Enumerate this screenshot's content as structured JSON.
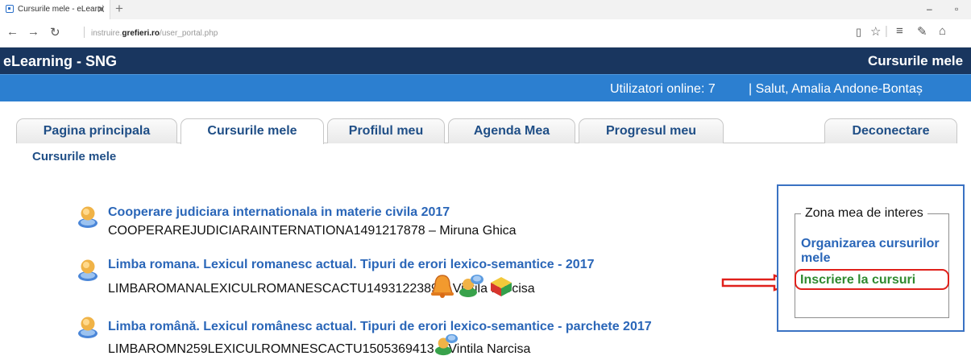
{
  "browser": {
    "tab_title": "Cursurile mele - eLearni",
    "tab_close": "✕",
    "new_tab": "+",
    "url_prefix": "instruire.",
    "url_domain": "grefieri.ro",
    "url_path": "/user_portal.php",
    "minimize": "–",
    "restore": "▫"
  },
  "header": {
    "brand": "eLearning - SNG",
    "section": "Cursurile mele",
    "online_label": "Utilizatori online:  7",
    "greeting": "| Salut, Amalia Andone-Bontaș"
  },
  "tabs": [
    {
      "label": "Pagina principala"
    },
    {
      "label": "Cursurile mele"
    },
    {
      "label": "Profilul meu"
    },
    {
      "label": "Agenda Mea"
    },
    {
      "label": "Progresul meu"
    }
  ],
  "logout": "Deconectare",
  "breadcrumb": "Cursurile mele",
  "courses": [
    {
      "title": "Cooperare judiciara internationala in materie civila 2017",
      "code": "COOPERAREJUDICIARAINTERNATIONA1491217878 – Miruna Ghica"
    },
    {
      "title": "Limba romana. Lexicul romanesc actual. Tipuri de erori lexico-semantice - 2017",
      "code": "LIMBAROMANALEXICULROMANESCACTU1493122389 – Vintila Narcisa"
    },
    {
      "title": "Limba română. Lexicul românesc actual. Tipuri de erori lexico-semantice - parchete 2017",
      "code": "LIMBAROMN259LEXICULROMNESCACTU1505369413 – Vintila Narcisa"
    }
  ],
  "interest_zone": {
    "legend": "Zona mea de interes",
    "organize_link": "Organizarea cursurilor mele",
    "enroll_link": "Inscriere la cursuri"
  },
  "colors": {
    "header_dark": "#19365f",
    "header_blue": "#2c7fd0",
    "link_blue": "#2a66b8",
    "enroll_green": "#2f8a2f",
    "highlight_red": "#e0201b"
  }
}
